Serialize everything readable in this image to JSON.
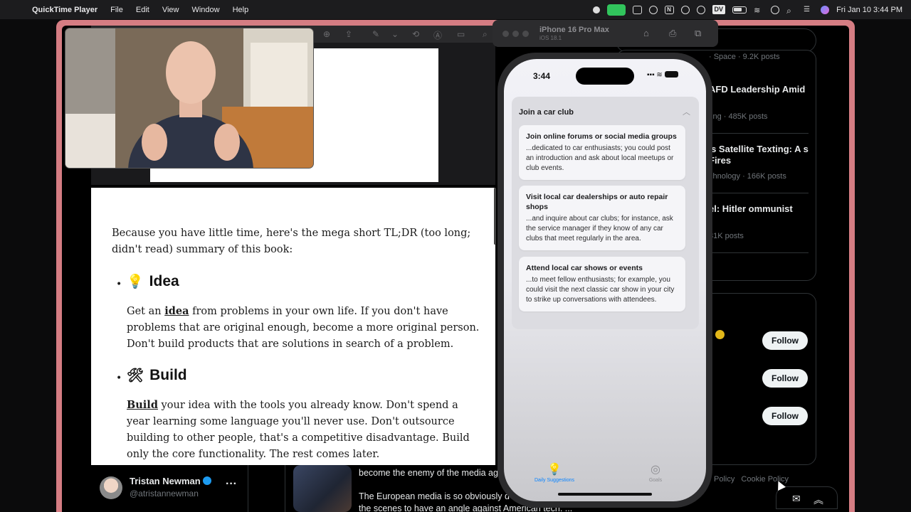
{
  "menubar": {
    "app_name": "QuickTime Player",
    "menus": [
      "File",
      "Edit",
      "View",
      "Window",
      "Help"
    ],
    "clock": "Fri Jan 10  3:44 PM",
    "dv_badge": "DV",
    "n_badge": "N"
  },
  "document": {
    "intro": "Because you have little time, here's the mega short TL;DR (too long; didn't read) summary of this book:",
    "sections": [
      {
        "emoji": "💡",
        "heading": "Idea",
        "link_word": "idea",
        "text_before": "Get an ",
        "text_after": " from problems in your own life. If you don't have problems that are original enough, become a more original person. Don't build products that are solutions in search of a problem."
      },
      {
        "emoji": "🛠",
        "heading": "Build",
        "link_word": "Build",
        "text_before": "",
        "text_after": " your idea with the tools you already know. Don't spend a year learning some language you'll never use. Don't outsource building to other people, that's a competitive disadvantage. Build only the core functionality. The rest comes later."
      }
    ]
  },
  "simulator": {
    "device": "iPhone 16 Pro Max",
    "os": "iOS 18.1"
  },
  "phone": {
    "time": "3:44",
    "section_title": "Join a car club",
    "cards": [
      {
        "title": "Join online forums or social media groups",
        "body": "...dedicated to car enthusiasts; you could post an introduction and ask about local meetups or club events."
      },
      {
        "title": "Visit local car dealerships or auto repair shops",
        "body": "...and inquire about car clubs; for instance, ask the service manager if they know of any car clubs that meet regularly in the area."
      },
      {
        "title": "Attend local car shows or events",
        "body": "...to meet fellow enthusiasts; for example, you could visit the next classic car show in your city to strike up conversations with attendees."
      }
    ],
    "tabs": [
      {
        "label": "Daily Suggestions",
        "icon": "lightbulb-icon",
        "active": true
      },
      {
        "label": "Goals",
        "icon": "target-icon",
        "active": false
      }
    ]
  },
  "x_sidebar": {
    "trends": [
      {
        "title": "",
        "meta": "· Space · 9.2K posts"
      },
      {
        "title": "AFD Leadership Amid",
        "meta": "ting · 485K posts"
      },
      {
        "title": "'s Satellite Texting: A s Fires",
        "meta": "chnology · 166K posts"
      },
      {
        "title": "el: Hitler ommunist",
        "meta": "81K posts"
      }
    ],
    "follow_label": "Follow",
    "footer": [
      "Policy",
      "Cookie Policy"
    ]
  },
  "x_profile": {
    "name": "Tristan Newman",
    "handle": "@atristannewman"
  },
  "tweet": {
    "line1": "become the enemy of the media ag",
    "line2": "The European media is so obviously d",
    "line3": "the scenes to have an angle against American tech. ..."
  },
  "colors": {
    "frame": "#d57d83",
    "accent_blue": "#1d9bf0",
    "ios_blue": "#0a84ff"
  }
}
